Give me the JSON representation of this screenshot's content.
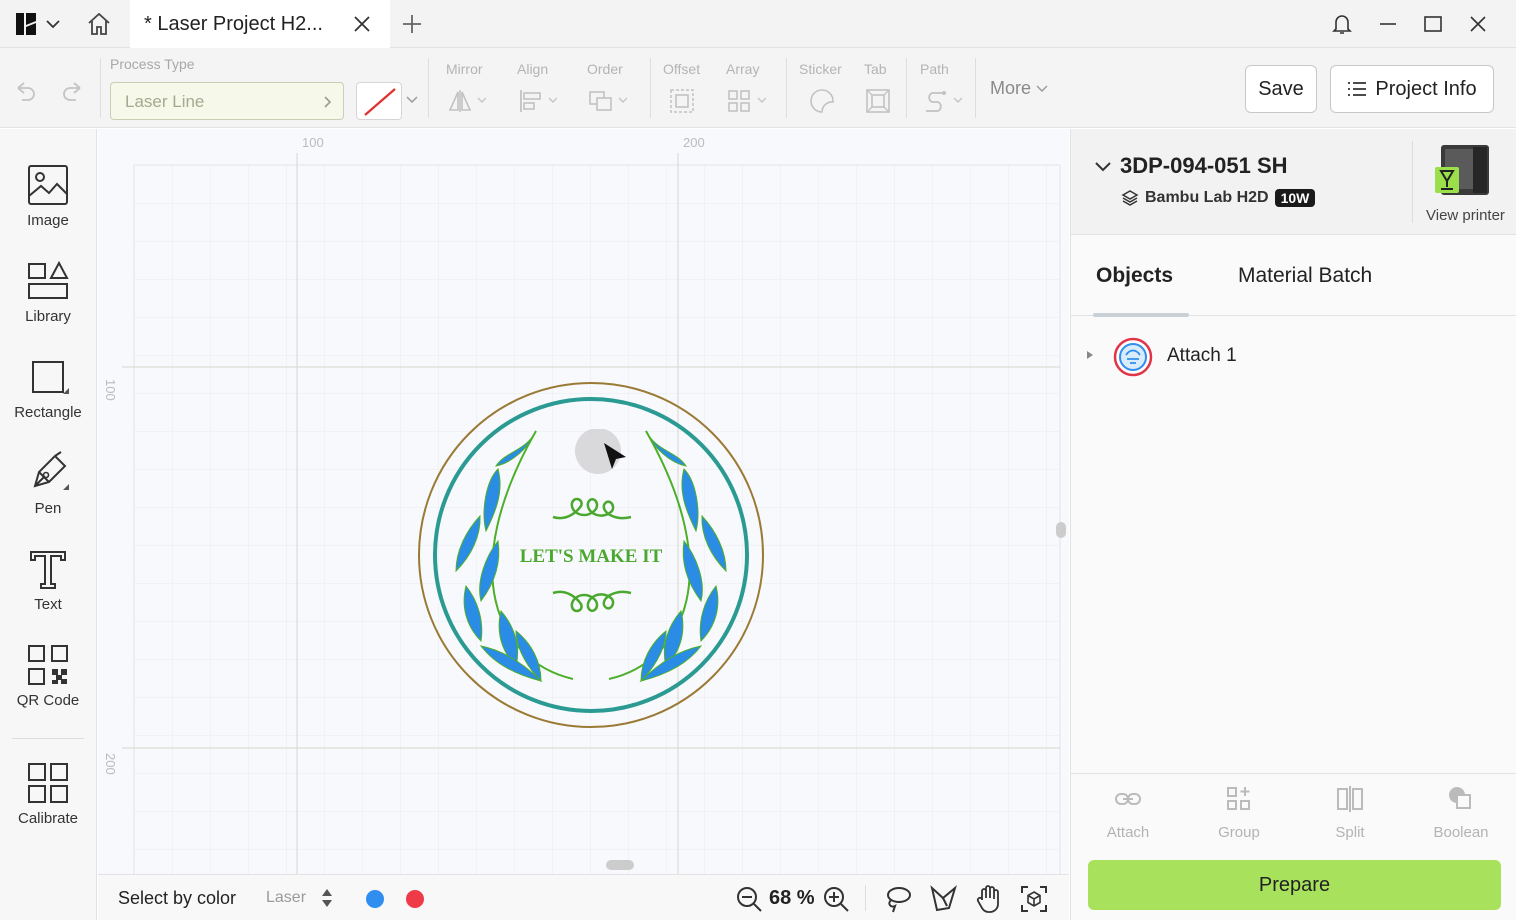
{
  "titlebar": {
    "tab_title": "* Laser Project H2...",
    "icons": [
      "app-logo-icon",
      "chevron-down-icon",
      "home-icon",
      "close-icon",
      "plus-icon",
      "bell-icon",
      "minimize-icon",
      "maximize-icon",
      "close-icon"
    ]
  },
  "toolbar": {
    "process_type_label": "Process Type",
    "process_type_value": "Laser Line",
    "line_color": "#e03030",
    "groups": {
      "mirror": "Mirror",
      "align": "Align",
      "order": "Order",
      "offset": "Offset",
      "array": "Array",
      "sticker": "Sticker",
      "tab": "Tab",
      "path": "Path"
    },
    "more_label": "More",
    "save_label": "Save",
    "project_info_label": "Project Info"
  },
  "sidebar": {
    "items": [
      {
        "label": "Image",
        "icon": "image-icon"
      },
      {
        "label": "Library",
        "icon": "library-icon"
      },
      {
        "label": "Rectangle",
        "icon": "rectangle-icon"
      },
      {
        "label": "Pen",
        "icon": "pen-icon"
      },
      {
        "label": "Text",
        "icon": "text-icon"
      },
      {
        "label": "QR Code",
        "icon": "qr-code-icon"
      },
      {
        "label": "Calibrate",
        "icon": "calibrate-icon"
      }
    ]
  },
  "canvas": {
    "ruler_top": [
      "100",
      "200"
    ],
    "ruler_left": [
      "100",
      "200"
    ],
    "design_text": "LET'S MAKE IT",
    "colors": {
      "ring": "#9a7a35",
      "teal": "#2a9a92",
      "leaf_blue": "#2b8ce6",
      "leaf_green": "#4caf2a",
      "text_green": "#4aa82e"
    }
  },
  "bottombar": {
    "select_by_color": "Select by color",
    "laser_select": "Laser",
    "color_dots": [
      "#2f8ef0",
      "#ef3b48"
    ],
    "zoom": "68 %"
  },
  "right_panel": {
    "printer_name": "3DP-094-051 SH",
    "printer_model": "Bambu Lab H2D",
    "power_badge": "10W",
    "view_printer": "View printer",
    "tabs": {
      "objects": "Objects",
      "material_batch": "Material Batch"
    },
    "objects": [
      {
        "label": "Attach 1"
      }
    ],
    "actions": {
      "attach": "Attach",
      "group": "Group",
      "split": "Split",
      "boolean": "Boolean"
    },
    "prepare_label": "Prepare",
    "accent": "#a8e25c"
  }
}
